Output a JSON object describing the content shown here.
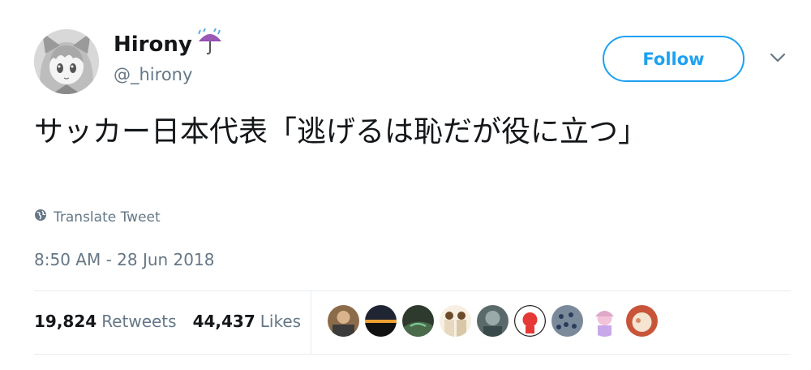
{
  "author": {
    "display_name": "Hirony",
    "handle": "@_hirony",
    "name_emoji_icon": "umbrella-with-rain-icon",
    "avatar_icon": "anime-girl-avatar"
  },
  "follow_button": {
    "label": "Follow",
    "color": "#1da1f2"
  },
  "menu_icon": "chevron-down-icon",
  "tweet": {
    "text": "サッカー日本代表「逃げるは恥だが役に立つ」"
  },
  "translate": {
    "label": "Translate Tweet",
    "icon": "globe-icon"
  },
  "timestamp": "8:50 AM - 28 Jun 2018",
  "stats": {
    "retweets_count": "19,824",
    "retweets_label": "Retweets",
    "likes_count": "44,437",
    "likes_label": "Likes"
  },
  "liked_by": [
    {
      "avatar": "user-avatar-1"
    },
    {
      "avatar": "user-avatar-2"
    },
    {
      "avatar": "user-avatar-3"
    },
    {
      "avatar": "user-avatar-4"
    },
    {
      "avatar": "user-avatar-5"
    },
    {
      "avatar": "user-avatar-6"
    },
    {
      "avatar": "user-avatar-7"
    },
    {
      "avatar": "user-avatar-8"
    },
    {
      "avatar": "user-avatar-9"
    }
  ],
  "colors": {
    "text_primary": "#14171a",
    "text_secondary": "#657786",
    "accent": "#1da1f2",
    "divider": "#e6ecf0"
  }
}
